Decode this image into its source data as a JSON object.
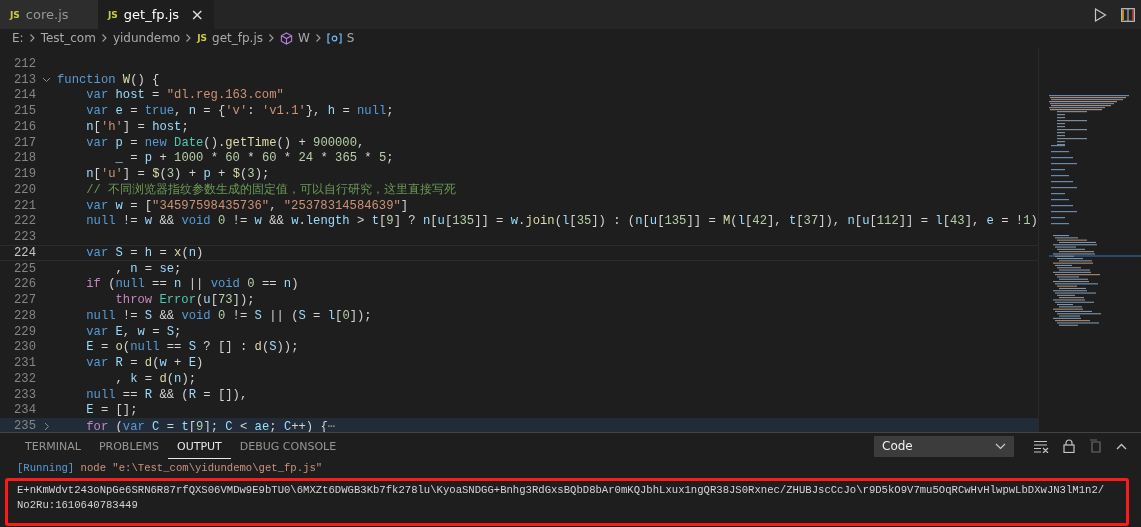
{
  "tabs": [
    {
      "label": "core.js",
      "badge": "JS",
      "selected": false
    },
    {
      "label": "get_fp.js",
      "badge": "JS",
      "selected": true,
      "close": "×"
    }
  ],
  "breadcrumb": [
    {
      "kind": "folder",
      "text": "E:"
    },
    {
      "kind": "folder",
      "text": "Test_com"
    },
    {
      "kind": "folder",
      "text": "yidundemo"
    },
    {
      "kind": "file",
      "text": "get_fp.js",
      "badge": "JS"
    },
    {
      "kind": "function",
      "text": "W"
    },
    {
      "kind": "variable",
      "text": "S"
    }
  ],
  "editor": {
    "lines": [
      {
        "num": "212",
        "current": false
      },
      {
        "num": "213",
        "current": false,
        "folded": false,
        "tokens": [
          {
            "kind": "k",
            "text": "function "
          },
          {
            "kind": "f",
            "text": "W"
          },
          {
            "kind": "p",
            "text": "() {"
          }
        ]
      },
      {
        "num": "214",
        "current": false,
        "tokens": [
          {
            "kind": "k",
            "text": "    var "
          },
          {
            "kind": "v",
            "text": "host"
          },
          {
            "kind": "p",
            "text": " = "
          },
          {
            "kind": "s",
            "text": "\"dl.reg.163.com\""
          }
        ]
      },
      {
        "num": "215",
        "current": false,
        "tokens": [
          {
            "kind": "k",
            "text": "    var "
          },
          {
            "kind": "v",
            "text": "e"
          },
          {
            "kind": "p",
            "text": " = "
          },
          {
            "kind": "k",
            "text": "true"
          },
          {
            "kind": "p",
            "text": ", "
          },
          {
            "kind": "v",
            "text": "n"
          },
          {
            "kind": "p",
            "text": " = {"
          },
          {
            "kind": "s",
            "text": "'v'"
          },
          {
            "kind": "p",
            "text": ": "
          },
          {
            "kind": "s",
            "text": "'v1.1'"
          },
          {
            "kind": "p",
            "text": "}, "
          },
          {
            "kind": "v",
            "text": "h"
          },
          {
            "kind": "p",
            "text": " = "
          },
          {
            "kind": "k",
            "text": "null"
          },
          {
            "kind": "p",
            "text": ";"
          }
        ]
      },
      {
        "num": "216",
        "current": false,
        "tokens": [
          {
            "kind": "v",
            "text": "    n"
          },
          {
            "kind": "p",
            "text": "["
          },
          {
            "kind": "s",
            "text": "'h'"
          },
          {
            "kind": "p",
            "text": "] = "
          },
          {
            "kind": "v",
            "text": "host"
          },
          {
            "kind": "p",
            "text": ";"
          }
        ]
      },
      {
        "num": "217",
        "current": false,
        "tokens": [
          {
            "kind": "k",
            "text": "    var "
          },
          {
            "kind": "v",
            "text": "p"
          },
          {
            "kind": "p",
            "text": " = "
          },
          {
            "kind": "k",
            "text": "new "
          },
          {
            "kind": "c",
            "text": "Date"
          },
          {
            "kind": "p",
            "text": "()."
          },
          {
            "kind": "f",
            "text": "getTime"
          },
          {
            "kind": "p",
            "text": "() + "
          },
          {
            "kind": "n",
            "text": "900000"
          },
          {
            "kind": "p",
            "text": ","
          }
        ]
      },
      {
        "num": "218",
        "current": false,
        "tokens": [
          {
            "kind": "v",
            "text": "        _"
          },
          {
            "kind": "p",
            "text": " = "
          },
          {
            "kind": "v",
            "text": "p"
          },
          {
            "kind": "p",
            "text": " + "
          },
          {
            "kind": "n",
            "text": "1000"
          },
          {
            "kind": "p",
            "text": " * "
          },
          {
            "kind": "n",
            "text": "60"
          },
          {
            "kind": "p",
            "text": " * "
          },
          {
            "kind": "n",
            "text": "60"
          },
          {
            "kind": "p",
            "text": " * "
          },
          {
            "kind": "n",
            "text": "24"
          },
          {
            "kind": "p",
            "text": " * "
          },
          {
            "kind": "n",
            "text": "365"
          },
          {
            "kind": "p",
            "text": " * "
          },
          {
            "kind": "n",
            "text": "5"
          },
          {
            "kind": "p",
            "text": ";"
          }
        ]
      },
      {
        "num": "219",
        "current": false,
        "tokens": [
          {
            "kind": "v",
            "text": "    n"
          },
          {
            "kind": "p",
            "text": "["
          },
          {
            "kind": "s",
            "text": "'u'"
          },
          {
            "kind": "p",
            "text": "] = "
          },
          {
            "kind": "f",
            "text": "$"
          },
          {
            "kind": "p",
            "text": "("
          },
          {
            "kind": "n",
            "text": "3"
          },
          {
            "kind": "p",
            "text": ") + "
          },
          {
            "kind": "v",
            "text": "p"
          },
          {
            "kind": "p",
            "text": " + "
          },
          {
            "kind": "f",
            "text": "$"
          },
          {
            "kind": "p",
            "text": "("
          },
          {
            "kind": "n",
            "text": "3"
          },
          {
            "kind": "p",
            "text": ");"
          }
        ]
      },
      {
        "num": "220",
        "current": false,
        "tokens": [
          {
            "kind": "m",
            "text": "    // 不同浏览器指纹参数生成的固定值，可以自行研究，这里直接写死"
          }
        ]
      },
      {
        "num": "221",
        "current": false,
        "tokens": [
          {
            "kind": "k",
            "text": "    var "
          },
          {
            "kind": "v",
            "text": "w"
          },
          {
            "kind": "p",
            "text": " = ["
          },
          {
            "kind": "s",
            "text": "\"34597598435736\""
          },
          {
            "kind": "p",
            "text": ", "
          },
          {
            "kind": "s",
            "text": "\"25378314584639\""
          },
          {
            "kind": "p",
            "text": "]"
          }
        ]
      },
      {
        "num": "222",
        "current": false,
        "tokens": [
          {
            "kind": "k",
            "text": "    null"
          },
          {
            "kind": "p",
            "text": " != "
          },
          {
            "kind": "v",
            "text": "w"
          },
          {
            "kind": "p",
            "text": " && "
          },
          {
            "kind": "k",
            "text": "void "
          },
          {
            "kind": "n",
            "text": "0"
          },
          {
            "kind": "p",
            "text": " != "
          },
          {
            "kind": "v",
            "text": "w"
          },
          {
            "kind": "p",
            "text": " && "
          },
          {
            "kind": "v",
            "text": "w"
          },
          {
            "kind": "p",
            "text": "."
          },
          {
            "kind": "v",
            "text": "length"
          },
          {
            "kind": "p",
            "text": " > "
          },
          {
            "kind": "v",
            "text": "t"
          },
          {
            "kind": "p",
            "text": "["
          },
          {
            "kind": "n",
            "text": "9"
          },
          {
            "kind": "p",
            "text": "] ? "
          },
          {
            "kind": "v",
            "text": "n"
          },
          {
            "kind": "p",
            "text": "["
          },
          {
            "kind": "v",
            "text": "u"
          },
          {
            "kind": "p",
            "text": "["
          },
          {
            "kind": "n",
            "text": "135"
          },
          {
            "kind": "p",
            "text": "]] = "
          },
          {
            "kind": "v",
            "text": "w"
          },
          {
            "kind": "p",
            "text": "."
          },
          {
            "kind": "f",
            "text": "join"
          },
          {
            "kind": "p",
            "text": "("
          },
          {
            "kind": "v",
            "text": "l"
          },
          {
            "kind": "p",
            "text": "["
          },
          {
            "kind": "n",
            "text": "35"
          },
          {
            "kind": "p",
            "text": "]) : ("
          },
          {
            "kind": "v",
            "text": "n"
          },
          {
            "kind": "p",
            "text": "["
          },
          {
            "kind": "v",
            "text": "u"
          },
          {
            "kind": "p",
            "text": "["
          },
          {
            "kind": "n",
            "text": "135"
          },
          {
            "kind": "p",
            "text": "]] = "
          },
          {
            "kind": "f",
            "text": "M"
          },
          {
            "kind": "p",
            "text": "("
          },
          {
            "kind": "v",
            "text": "l"
          },
          {
            "kind": "p",
            "text": "["
          },
          {
            "kind": "n",
            "text": "42"
          },
          {
            "kind": "p",
            "text": "], "
          },
          {
            "kind": "v",
            "text": "t"
          },
          {
            "kind": "p",
            "text": "["
          },
          {
            "kind": "n",
            "text": "37"
          },
          {
            "kind": "p",
            "text": "]), "
          },
          {
            "kind": "v",
            "text": "n"
          },
          {
            "kind": "p",
            "text": "["
          },
          {
            "kind": "v",
            "text": "u"
          },
          {
            "kind": "p",
            "text": "["
          },
          {
            "kind": "n",
            "text": "112"
          },
          {
            "kind": "p",
            "text": "]] = "
          },
          {
            "kind": "v",
            "text": "l"
          },
          {
            "kind": "p",
            "text": "["
          },
          {
            "kind": "n",
            "text": "43"
          },
          {
            "kind": "p",
            "text": "], "
          },
          {
            "kind": "v",
            "text": "e"
          },
          {
            "kind": "p",
            "text": " = !"
          },
          {
            "kind": "n",
            "text": "1"
          },
          {
            "kind": "p",
            "text": ")"
          }
        ]
      },
      {
        "num": "223",
        "current": false
      },
      {
        "num": "224",
        "current": true,
        "tokens": [
          {
            "kind": "k",
            "text": "    var "
          },
          {
            "kind": "v",
            "text": "S"
          },
          {
            "kind": "p",
            "text": " = "
          },
          {
            "kind": "v",
            "text": "h"
          },
          {
            "kind": "p",
            "text": " = "
          },
          {
            "kind": "f",
            "text": "x"
          },
          {
            "kind": "p",
            "text": "("
          },
          {
            "kind": "v",
            "text": "n"
          },
          {
            "kind": "p",
            "text": ")"
          }
        ]
      },
      {
        "num": "225",
        "current": false,
        "tokens": [
          {
            "kind": "p",
            "text": "        , "
          },
          {
            "kind": "v",
            "text": "n"
          },
          {
            "kind": "p",
            "text": " = "
          },
          {
            "kind": "v",
            "text": "se"
          },
          {
            "kind": "p",
            "text": ";"
          }
        ]
      },
      {
        "num": "226",
        "current": false,
        "tokens": [
          {
            "kind": "x",
            "text": "    if "
          },
          {
            "kind": "p",
            "text": "("
          },
          {
            "kind": "k",
            "text": "null"
          },
          {
            "kind": "p",
            "text": " == "
          },
          {
            "kind": "v",
            "text": "n"
          },
          {
            "kind": "p",
            "text": " || "
          },
          {
            "kind": "k",
            "text": "void "
          },
          {
            "kind": "n",
            "text": "0"
          },
          {
            "kind": "p",
            "text": " == "
          },
          {
            "kind": "v",
            "text": "n"
          },
          {
            "kind": "p",
            "text": ")"
          }
        ]
      },
      {
        "num": "227",
        "current": false,
        "tokens": [
          {
            "kind": "x",
            "text": "        throw "
          },
          {
            "kind": "c",
            "text": "Error"
          },
          {
            "kind": "p",
            "text": "("
          },
          {
            "kind": "v",
            "text": "u"
          },
          {
            "kind": "p",
            "text": "["
          },
          {
            "kind": "n",
            "text": "73"
          },
          {
            "kind": "p",
            "text": "]);"
          }
        ]
      },
      {
        "num": "228",
        "current": false,
        "tokens": [
          {
            "kind": "k",
            "text": "    null"
          },
          {
            "kind": "p",
            "text": " != "
          },
          {
            "kind": "v",
            "text": "S"
          },
          {
            "kind": "p",
            "text": " && "
          },
          {
            "kind": "k",
            "text": "void "
          },
          {
            "kind": "n",
            "text": "0"
          },
          {
            "kind": "p",
            "text": " != "
          },
          {
            "kind": "v",
            "text": "S"
          },
          {
            "kind": "p",
            "text": " || ("
          },
          {
            "kind": "v",
            "text": "S"
          },
          {
            "kind": "p",
            "text": " = "
          },
          {
            "kind": "v",
            "text": "l"
          },
          {
            "kind": "p",
            "text": "["
          },
          {
            "kind": "n",
            "text": "0"
          },
          {
            "kind": "p",
            "text": "]);"
          }
        ]
      },
      {
        "num": "229",
        "current": false,
        "tokens": [
          {
            "kind": "k",
            "text": "    var "
          },
          {
            "kind": "v",
            "text": "E"
          },
          {
            "kind": "p",
            "text": ", "
          },
          {
            "kind": "v",
            "text": "w"
          },
          {
            "kind": "p",
            "text": " = "
          },
          {
            "kind": "v",
            "text": "S"
          },
          {
            "kind": "p",
            "text": ";"
          }
        ]
      },
      {
        "num": "230",
        "current": false,
        "tokens": [
          {
            "kind": "v",
            "text": "    E"
          },
          {
            "kind": "p",
            "text": " = "
          },
          {
            "kind": "f",
            "text": "o"
          },
          {
            "kind": "p",
            "text": "("
          },
          {
            "kind": "k",
            "text": "null"
          },
          {
            "kind": "p",
            "text": " == "
          },
          {
            "kind": "v",
            "text": "S"
          },
          {
            "kind": "p",
            "text": " ? [] : "
          },
          {
            "kind": "f",
            "text": "d"
          },
          {
            "kind": "p",
            "text": "("
          },
          {
            "kind": "v",
            "text": "S"
          },
          {
            "kind": "p",
            "text": "));"
          }
        ]
      },
      {
        "num": "231",
        "current": false,
        "tokens": [
          {
            "kind": "k",
            "text": "    var "
          },
          {
            "kind": "v",
            "text": "R"
          },
          {
            "kind": "p",
            "text": " = "
          },
          {
            "kind": "f",
            "text": "d"
          },
          {
            "kind": "p",
            "text": "("
          },
          {
            "kind": "v",
            "text": "w"
          },
          {
            "kind": "p",
            "text": " + "
          },
          {
            "kind": "v",
            "text": "E"
          },
          {
            "kind": "p",
            "text": ")"
          }
        ]
      },
      {
        "num": "232",
        "current": false,
        "tokens": [
          {
            "kind": "p",
            "text": "        , "
          },
          {
            "kind": "v",
            "text": "k"
          },
          {
            "kind": "p",
            "text": " = "
          },
          {
            "kind": "f",
            "text": "d"
          },
          {
            "kind": "p",
            "text": "("
          },
          {
            "kind": "v",
            "text": "n"
          },
          {
            "kind": "p",
            "text": ");"
          }
        ]
      },
      {
        "num": "233",
        "current": false,
        "tokens": [
          {
            "kind": "k",
            "text": "    null"
          },
          {
            "kind": "p",
            "text": " == "
          },
          {
            "kind": "v",
            "text": "R"
          },
          {
            "kind": "p",
            "text": " && ("
          },
          {
            "kind": "v",
            "text": "R"
          },
          {
            "kind": "p",
            "text": " = []),"
          }
        ]
      },
      {
        "num": "234",
        "current": false,
        "tokens": [
          {
            "kind": "v",
            "text": "    E"
          },
          {
            "kind": "p",
            "text": " = [];"
          }
        ]
      },
      {
        "num": "235",
        "current": false,
        "folded": true,
        "tokens": [
          {
            "kind": "x",
            "text": "    for "
          },
          {
            "kind": "p",
            "text": "("
          },
          {
            "kind": "k",
            "text": "var "
          },
          {
            "kind": "v",
            "text": "C"
          },
          {
            "kind": "p",
            "text": " = "
          },
          {
            "kind": "v",
            "text": "t"
          },
          {
            "kind": "p",
            "text": "["
          },
          {
            "kind": "n",
            "text": "9"
          },
          {
            "kind": "p",
            "text": "]; "
          },
          {
            "kind": "v",
            "text": "C"
          },
          {
            "kind": "p",
            "text": " < "
          },
          {
            "kind": "v",
            "text": "ae"
          },
          {
            "kind": "p",
            "text": "; "
          },
          {
            "kind": "v",
            "text": "C"
          },
          {
            "kind": "p",
            "text": "++) {"
          },
          {
            "kind": "g",
            "text": "⋯"
          }
        ]
      }
    ]
  },
  "panel": {
    "tabs": [
      {
        "label": "TERMINAL",
        "selected": false
      },
      {
        "label": "PROBLEMS",
        "selected": false
      },
      {
        "label": "OUTPUT",
        "selected": true
      },
      {
        "label": "DEBUG CONSOLE",
        "selected": false
      }
    ],
    "channel": "Code",
    "output": [
      {
        "kind": "command",
        "tag": "[Running]",
        "text": "node \"e:\\Test_com\\yidundemo\\get_fp.js\"",
        "highlighted": false
      },
      {
        "kind": "result",
        "lines": [
          "E+nKmWdvt243oNpGe6SRN6R87rfQXS06VMDw9E9bTU0\\6MXZt6DWGB3Kb7fk278lu\\KyoaSNDGG+Bnhg3RdGxsBQbD8bAr0mKQJbhLxux1ngQR38JS0Rxnec/ZHUBJscCcJo\\r9D5kO9V7mu5OqRCwHvHlwpwLbDXwJN3lM1n2/",
          "No2Ru:1610640783449"
        ],
        "highlighted": true
      }
    ]
  }
}
